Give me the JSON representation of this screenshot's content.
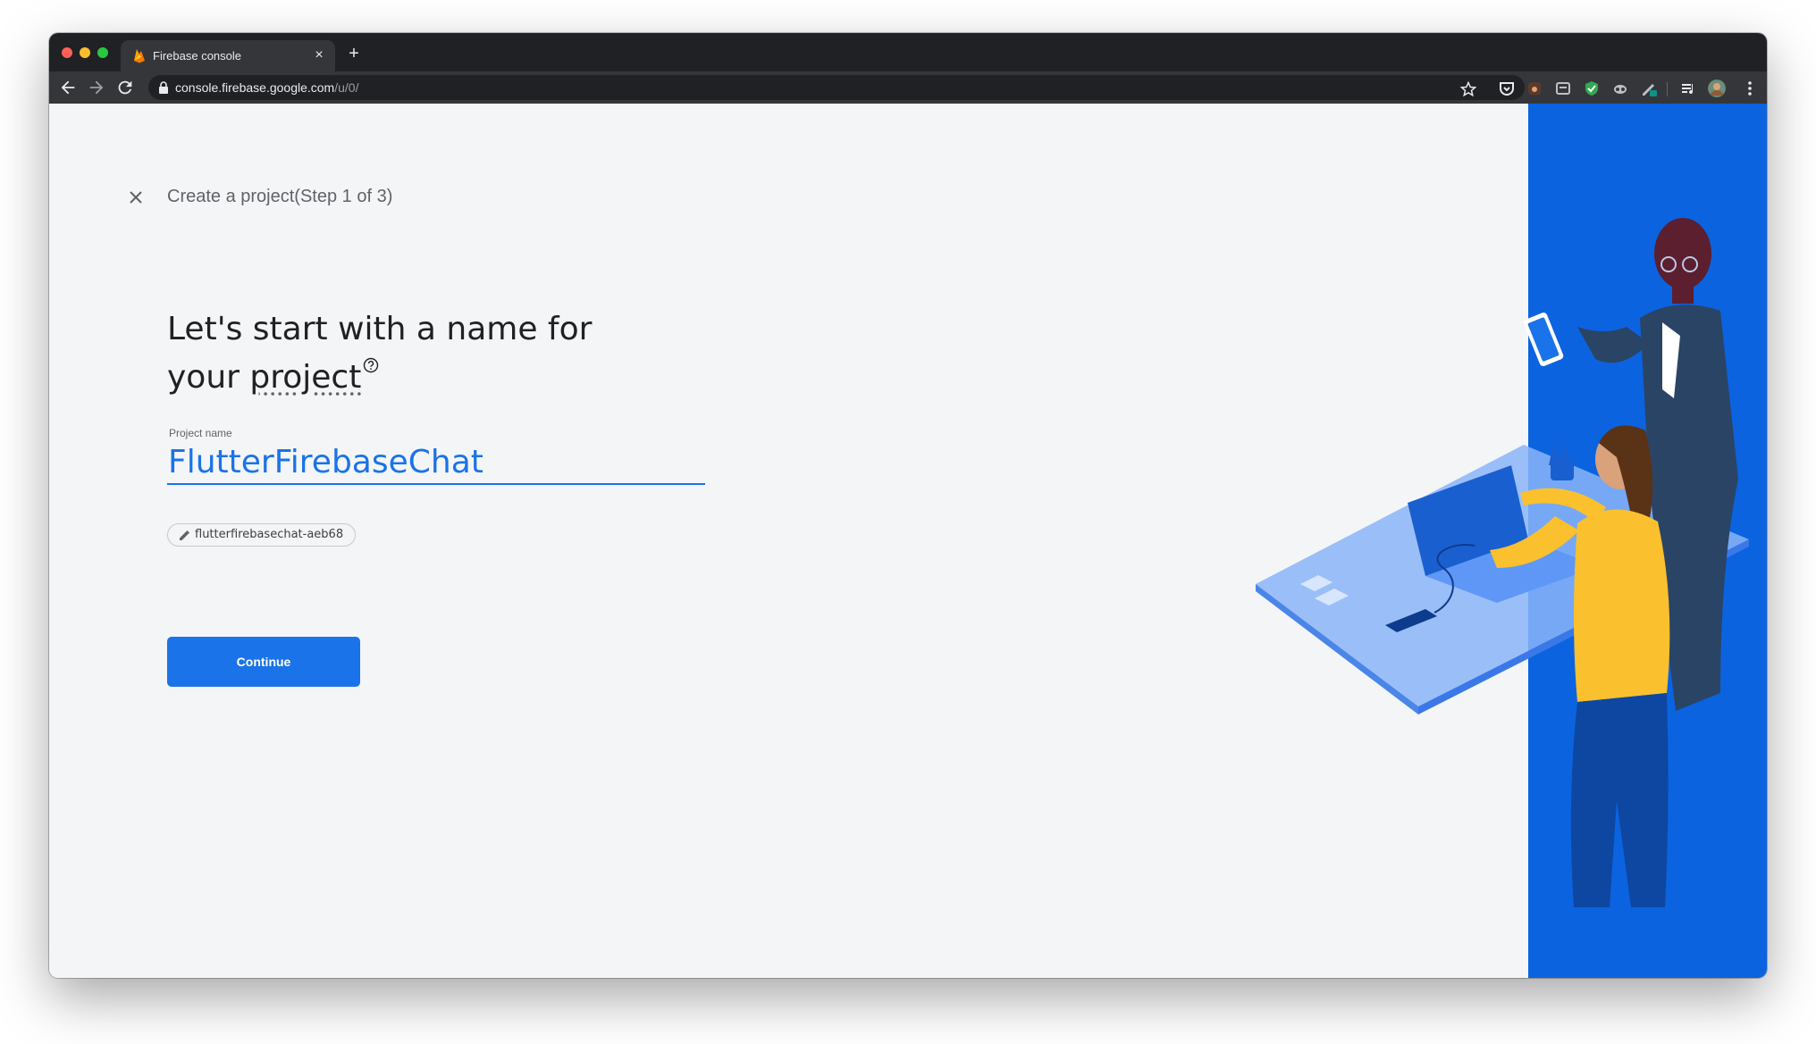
{
  "browser": {
    "tab_title": "Firebase console",
    "tab_close": "×",
    "new_tab": "+",
    "url_host": "console.firebase.google.com",
    "url_path": "/u/0/"
  },
  "page": {
    "step_text": "Create a project(Step 1 of 3)",
    "headline_line1": "Let's start with a name for",
    "headline_line2_prefix": "your ",
    "headline_project": "project",
    "field_label": "Project name",
    "project_name_value": "FlutterFirebaseChat",
    "project_id_chip": "flutterfirebasechat-aeb68",
    "continue_label": "Continue"
  },
  "colors": {
    "accent": "#1a73e8",
    "illustration_blue": "#0b63e0",
    "chrome_dark": "#202124",
    "chrome_toolbar": "#35363a"
  },
  "icons": [
    "firebase-favicon-icon",
    "back-arrow-icon",
    "forward-arrow-icon",
    "reload-icon",
    "lock-icon",
    "bookmark-star-icon",
    "pocket-extension-icon",
    "extension-icon",
    "shield-extension-icon",
    "adblock-extension-icon",
    "incognito-extension-icon",
    "pen-extension-icon",
    "playlist-icon",
    "profile-avatar-icon",
    "more-menu-icon",
    "close-icon",
    "help-icon",
    "edit-pencil-icon"
  ]
}
